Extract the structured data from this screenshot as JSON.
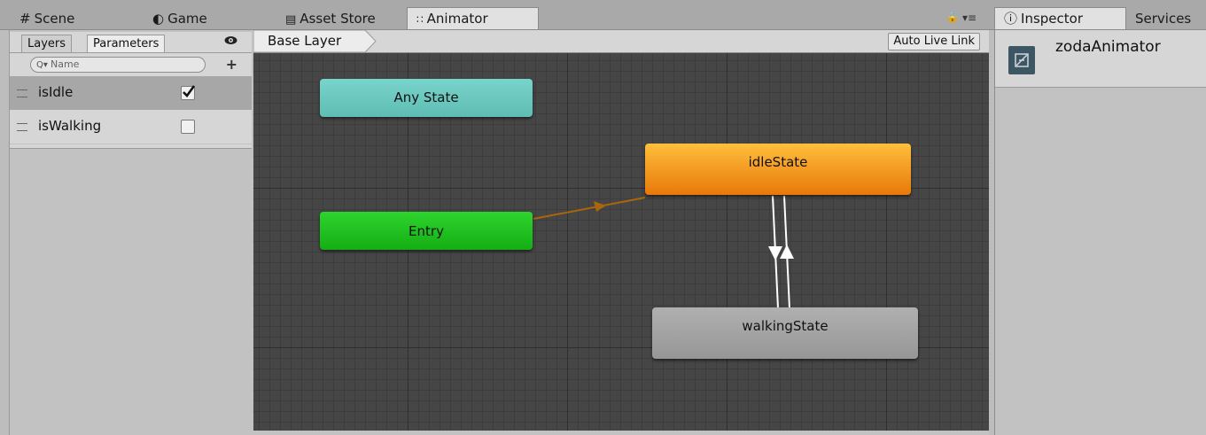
{
  "top_tabs": {
    "scene": "Scene",
    "game": "Game",
    "asset_store": "Asset Store",
    "animator": "Animator",
    "inspector": "Inspector",
    "services": "Services"
  },
  "left_panel": {
    "tabs": {
      "layers": "Layers",
      "parameters": "Parameters"
    },
    "search_placeholder": "Name",
    "parameters": [
      {
        "name": "isIdle",
        "checked": true
      },
      {
        "name": "isWalking",
        "checked": false
      }
    ]
  },
  "graph": {
    "breadcrumb": "Base Layer",
    "auto_live_link": "Auto Live Link",
    "nodes": {
      "any_state": "Any State",
      "entry": "Entry",
      "idle_state": "idleState",
      "walking_state": "walkingState"
    }
  },
  "inspector": {
    "object_name": "zodaAnimator"
  },
  "colors": {
    "any_state": "#6cc9c0",
    "entry": "#1fbf1f",
    "idle_state": "#f39214",
    "walking_state": "#a3a3a3",
    "entry_transition": "#a9660a"
  }
}
